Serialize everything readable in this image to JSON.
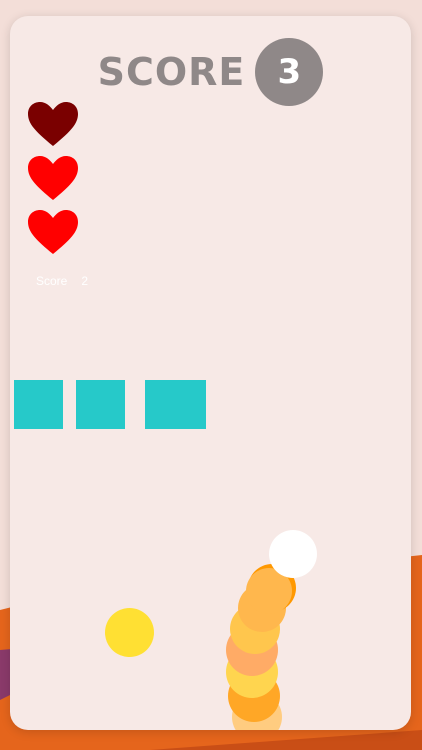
{
  "header": {
    "score_word": "SCORE",
    "score_value": "3"
  },
  "lives": {
    "count": 3,
    "lost": 1,
    "lost_color": "#7a0000",
    "color": "#ff0000"
  },
  "secondary_score": {
    "label": "Score",
    "value": "2"
  },
  "blocks": {
    "count": 3,
    "color": "#26c9c9"
  },
  "player": {
    "head_color": "#ffffff",
    "trail_colors": [
      "#ffa726",
      "#ffb74d",
      "#ffd54f",
      "#ff9800"
    ]
  },
  "pickup": {
    "color": "#ffe033"
  },
  "colors": {
    "card": "#f7e9e6",
    "score_gray": "#8f8888",
    "bg_orange": "#e5651c",
    "bg_purple": "#8a3a6a"
  }
}
